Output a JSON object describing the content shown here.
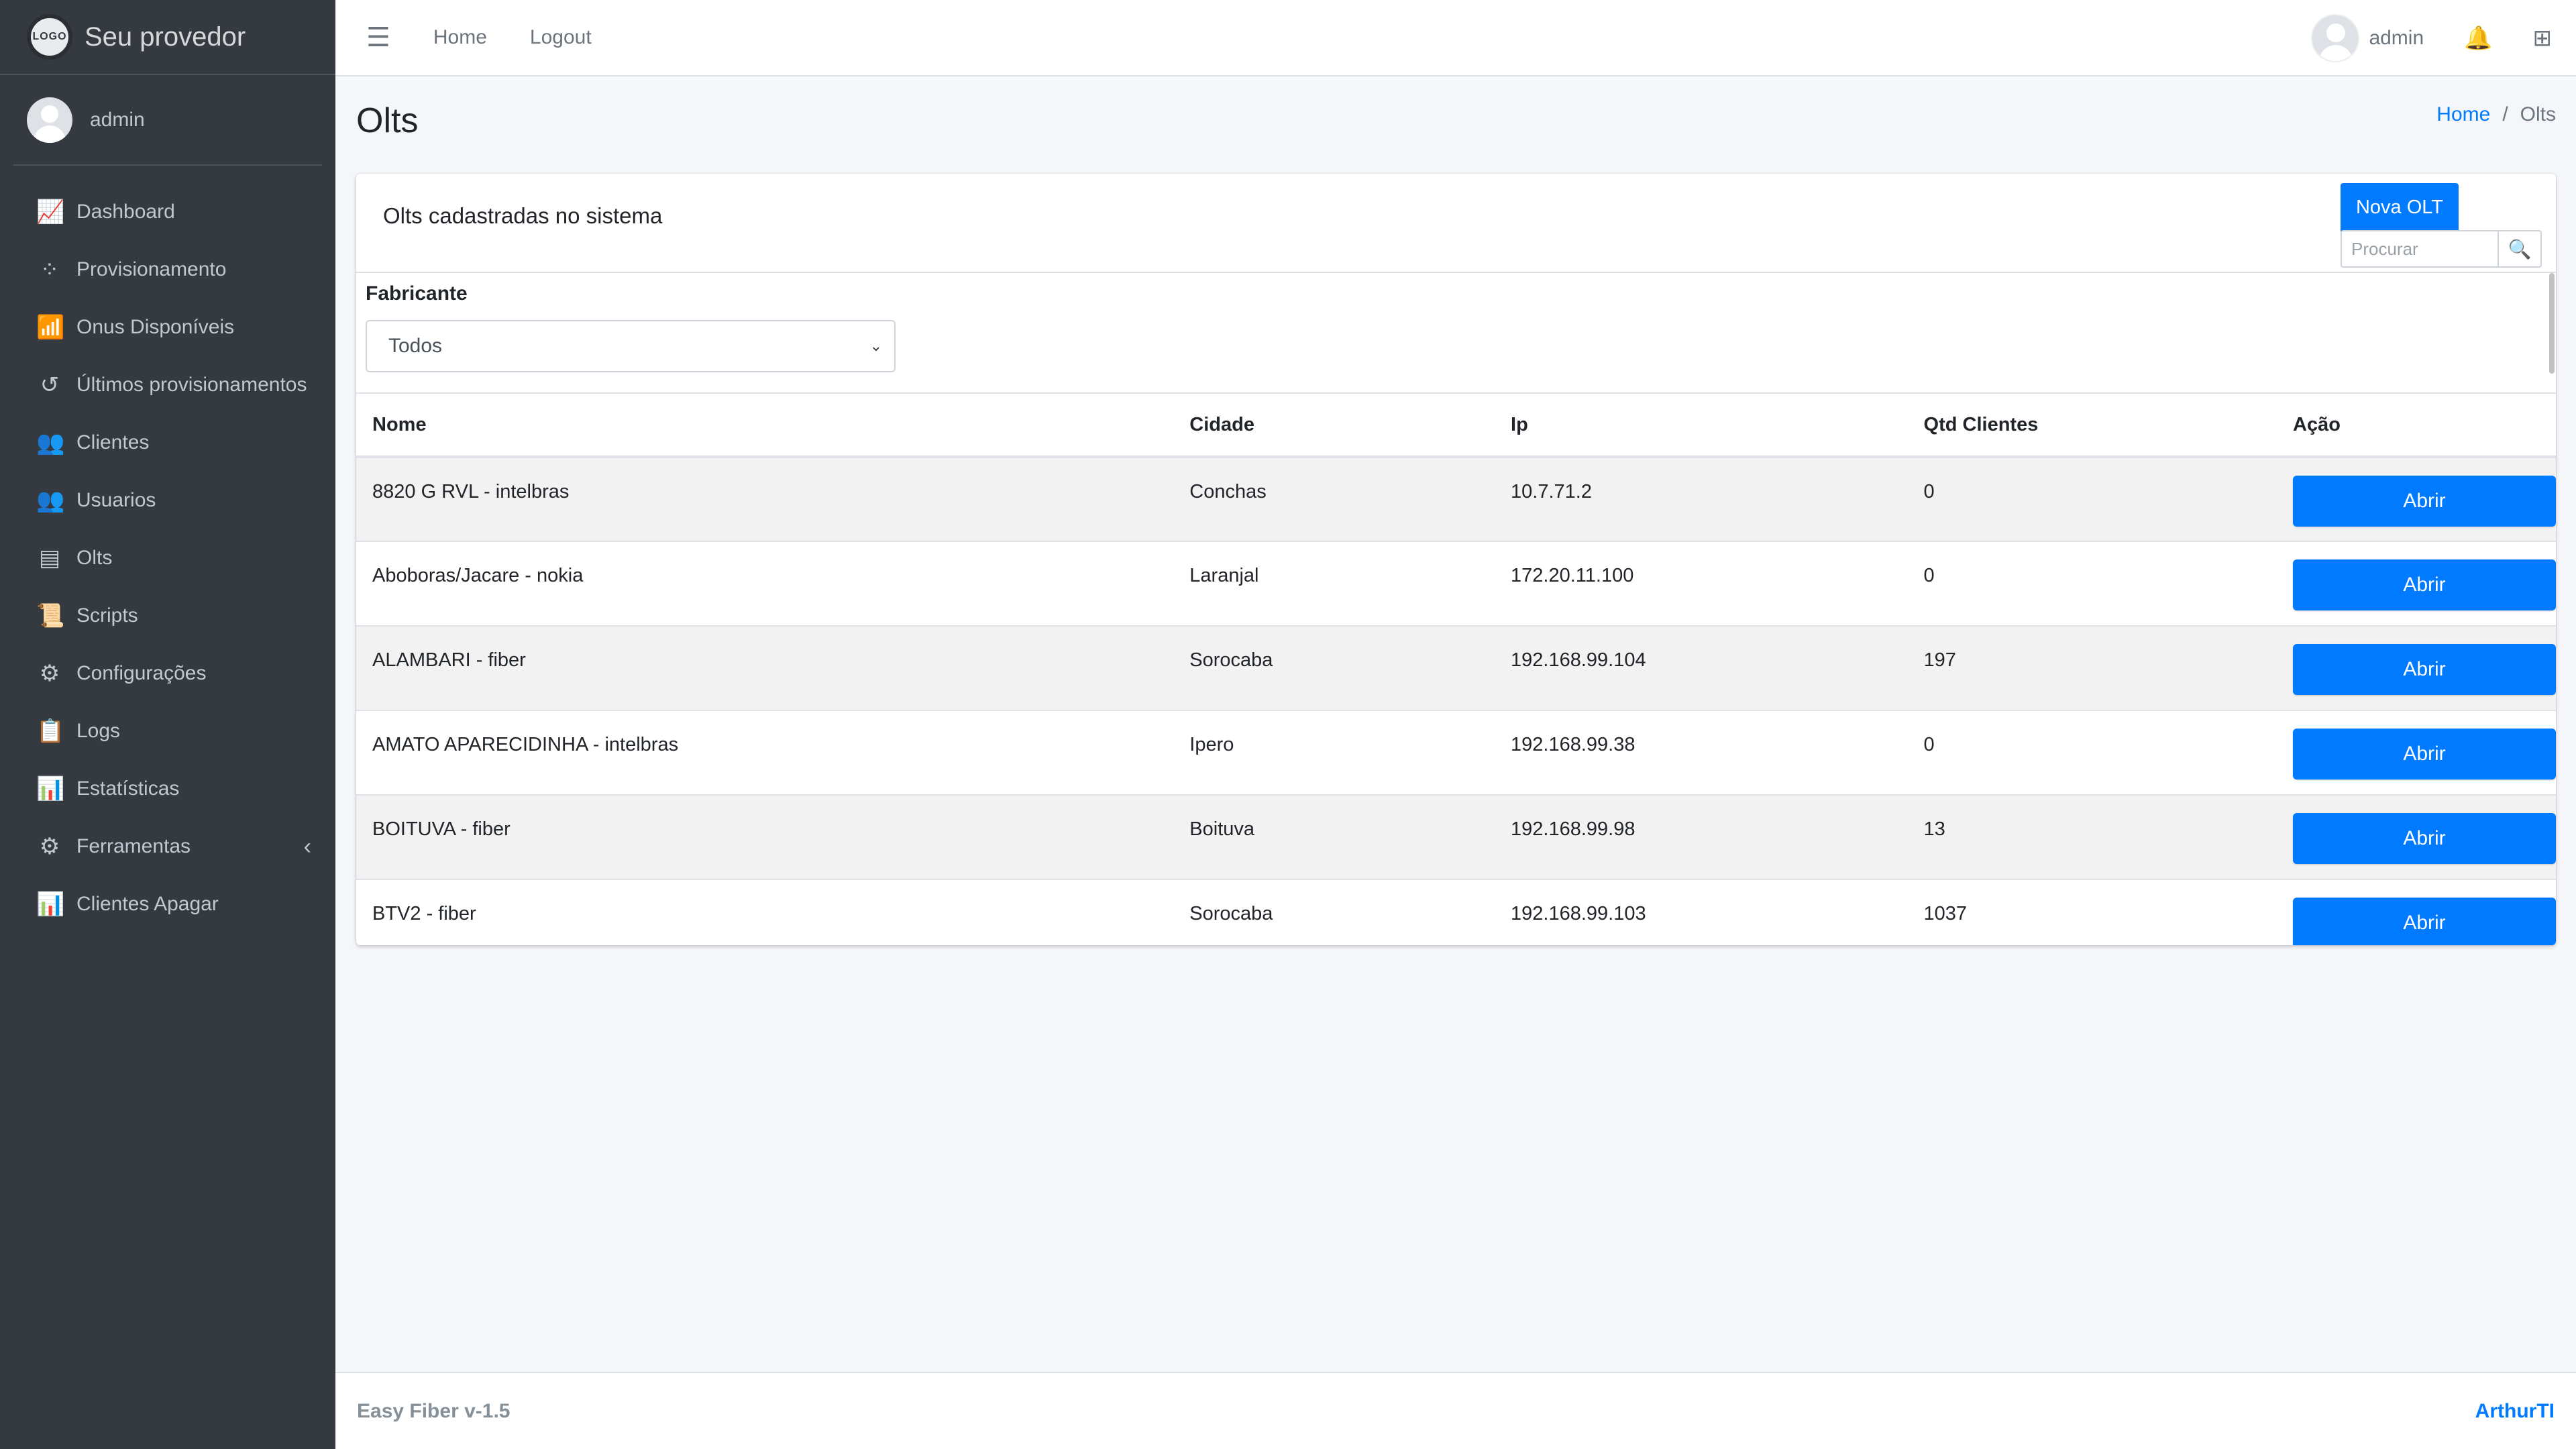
{
  "brand": {
    "logo_text": "LOGO",
    "name": "Seu provedor"
  },
  "sidebar": {
    "user": "admin",
    "items": [
      {
        "label": "Dashboard",
        "icon": "📈"
      },
      {
        "label": "Provisionamento",
        "icon": "⁘"
      },
      {
        "label": "Onus Disponíveis",
        "icon": "📶"
      },
      {
        "label": "Últimos provisionamentos",
        "icon": "↺"
      },
      {
        "label": "Clientes",
        "icon": "👥"
      },
      {
        "label": "Usuarios",
        "icon": "👥"
      },
      {
        "label": "Olts",
        "icon": "▤"
      },
      {
        "label": "Scripts",
        "icon": "📜"
      },
      {
        "label": "Configurações",
        "icon": "⚙"
      },
      {
        "label": "Logs",
        "icon": "📋"
      },
      {
        "label": "Estatísticas",
        "icon": "📊"
      },
      {
        "label": "Ferramentas",
        "icon": "⚙",
        "arrow": "‹"
      },
      {
        "label": "Clientes Apagar",
        "icon": "📊"
      }
    ]
  },
  "topbar": {
    "menu_icon": "☰",
    "home": "Home",
    "logout": "Logout",
    "user": "admin",
    "bell_icon": "🔔",
    "grid_icon": "⊞"
  },
  "page": {
    "title": "Olts",
    "breadcrumb_home": "Home",
    "breadcrumb_sep": "/",
    "breadcrumb_current": "Olts"
  },
  "card": {
    "title": "Olts cadastradas no sistema",
    "new_button": "Nova OLT",
    "search_placeholder": "Procurar",
    "search_icon": "🔍"
  },
  "filter": {
    "label": "Fabricante",
    "value": "Todos",
    "caret": "⌄"
  },
  "table": {
    "headers": [
      "Nome",
      "Cidade",
      "Ip",
      "Qtd Clientes",
      "Ação"
    ],
    "rows": [
      {
        "nome": "8820 G RVL - intelbras",
        "cidade": "Conchas",
        "ip": "10.7.71.2",
        "qtd": "0",
        "acao": "Abrir"
      },
      {
        "nome": "Aboboras/Jacare - nokia",
        "cidade": "Laranjal",
        "ip": "172.20.11.100",
        "qtd": "0",
        "acao": "Abrir"
      },
      {
        "nome": "ALAMBARI - fiber",
        "cidade": "Sorocaba",
        "ip": "192.168.99.104",
        "qtd": "197",
        "acao": "Abrir"
      },
      {
        "nome": "AMATO APARECIDINHA - intelbras",
        "cidade": "Ipero",
        "ip": "192.168.99.38",
        "qtd": "0",
        "acao": "Abrir"
      },
      {
        "nome": "BOITUVA - fiber",
        "cidade": "Boituva",
        "ip": "192.168.99.98",
        "qtd": "13",
        "acao": "Abrir"
      },
      {
        "nome": "BTV2 - fiber",
        "cidade": "Sorocaba",
        "ip": "192.168.99.103",
        "qtd": "1037",
        "acao": "Abrir"
      }
    ]
  },
  "footer": {
    "left": "Easy Fiber v-1.5",
    "right": "ArthurTI"
  },
  "colors": {
    "sidebar": "#343a40",
    "primary": "#007bff",
    "background": "#f4f6f9"
  }
}
